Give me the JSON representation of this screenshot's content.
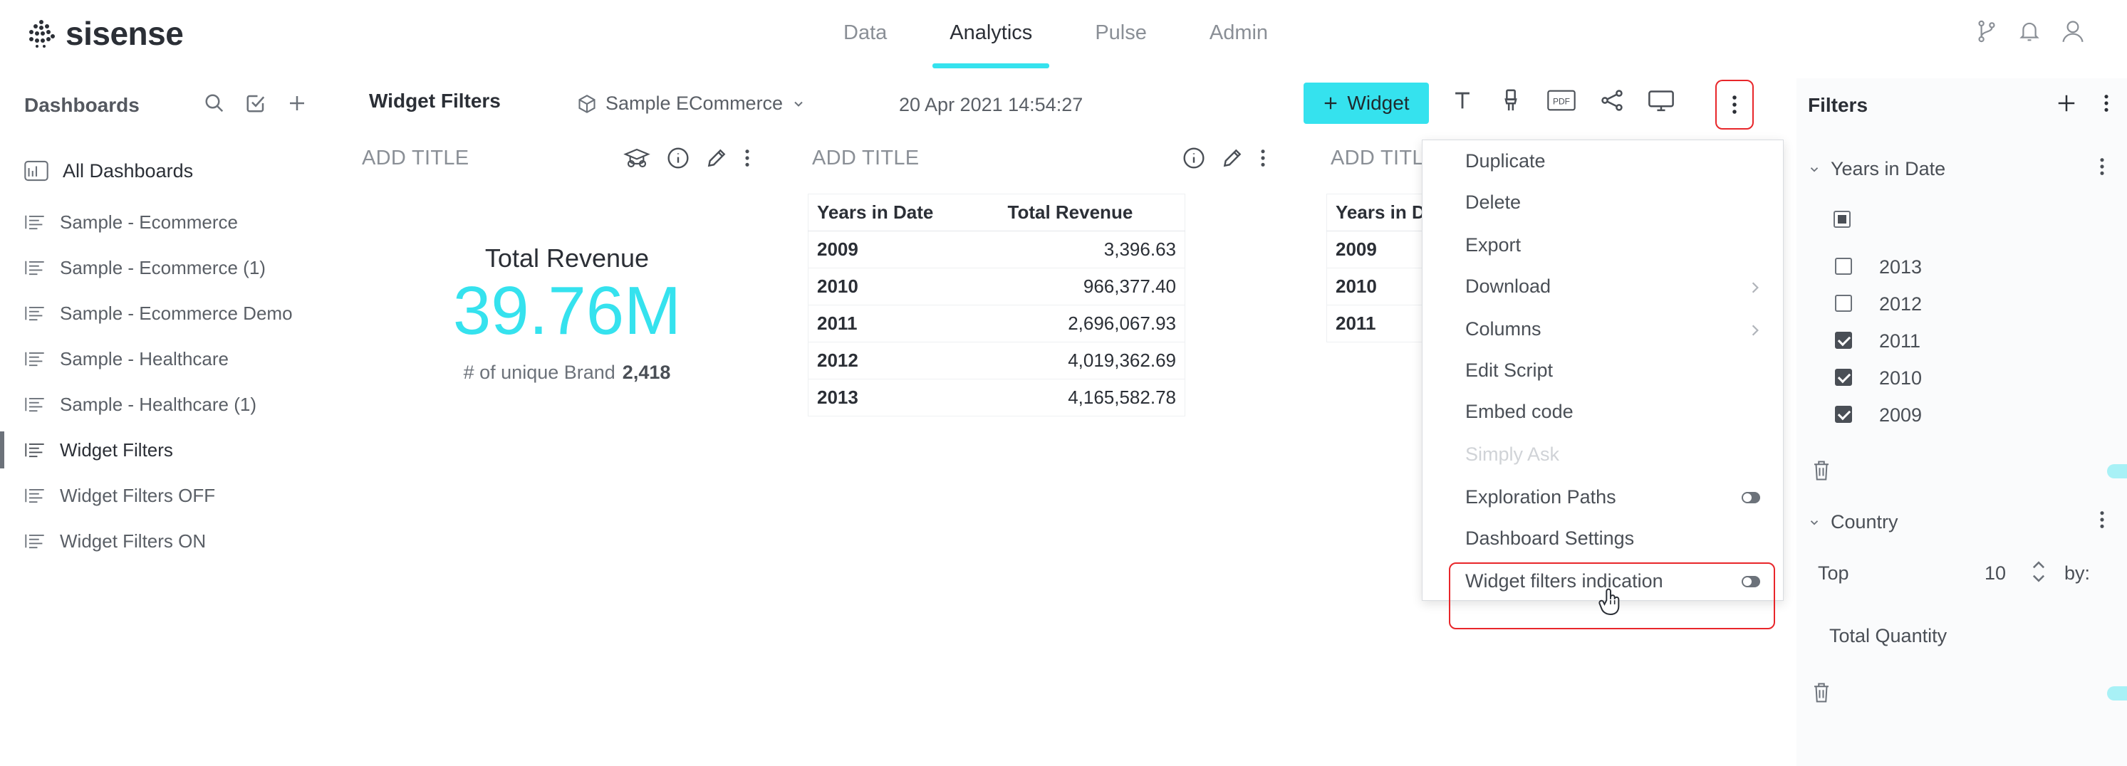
{
  "app": {
    "name": "sisense"
  },
  "nav": {
    "items": [
      "Data",
      "Analytics",
      "Pulse",
      "Admin"
    ],
    "active": "Analytics"
  },
  "subbar": {
    "dashboards_label": "Dashboards",
    "dashboard_title": "Widget Filters",
    "datasource": "Sample ECommerce",
    "datetime": "20 Apr 2021 14:54:27",
    "widget_button": "Widget"
  },
  "sidebar": {
    "all_label": "All Dashboards",
    "items": [
      "Sample - Ecommerce",
      "Sample - Ecommerce (1)",
      "Sample - Ecommerce Demo",
      "Sample - Healthcare",
      "Sample - Healthcare (1)",
      "Widget Filters",
      "Widget Filters OFF",
      "Widget Filters ON"
    ],
    "active_index": 5
  },
  "widgets": {
    "kpi": {
      "title": "ADD TITLE",
      "label": "Total Revenue",
      "value": "39.76M",
      "sub_label": "# of unique Brand",
      "sub_value": "2,418"
    },
    "table1": {
      "title": "ADD TITLE",
      "headers": [
        "Years in Date",
        "Total Revenue"
      ],
      "rows": [
        [
          "2009",
          "3,396.63"
        ],
        [
          "2010",
          "966,377.40"
        ],
        [
          "2011",
          "2,696,067.93"
        ],
        [
          "2012",
          "4,019,362.69"
        ],
        [
          "2013",
          "4,165,582.78"
        ]
      ]
    },
    "table2": {
      "title": "ADD TITL",
      "header": "Years in D",
      "rows": [
        "2009",
        "2010",
        "2011"
      ]
    }
  },
  "menu": {
    "items": [
      "Duplicate",
      "Delete",
      "Export",
      "Download",
      "Columns",
      "Edit Script",
      "Embed code",
      "Simply Ask",
      "Exploration Paths",
      "Dashboard Settings",
      "Widget filters indication"
    ]
  },
  "filters": {
    "title": "Filters",
    "group1": {
      "title": "Years in Date",
      "options": [
        {
          "label": "2013",
          "checked": false
        },
        {
          "label": "2012",
          "checked": false
        },
        {
          "label": "2011",
          "checked": true
        },
        {
          "label": "2010",
          "checked": true
        },
        {
          "label": "2009",
          "checked": true
        }
      ]
    },
    "group2": {
      "title": "Country",
      "top_label": "Top",
      "top_value": "10",
      "by_label": "by:",
      "measure": "Total Quantity"
    }
  },
  "colors": {
    "accent": "#35e2ee",
    "highlight": "#e8262a",
    "text": "#2b2f36"
  }
}
